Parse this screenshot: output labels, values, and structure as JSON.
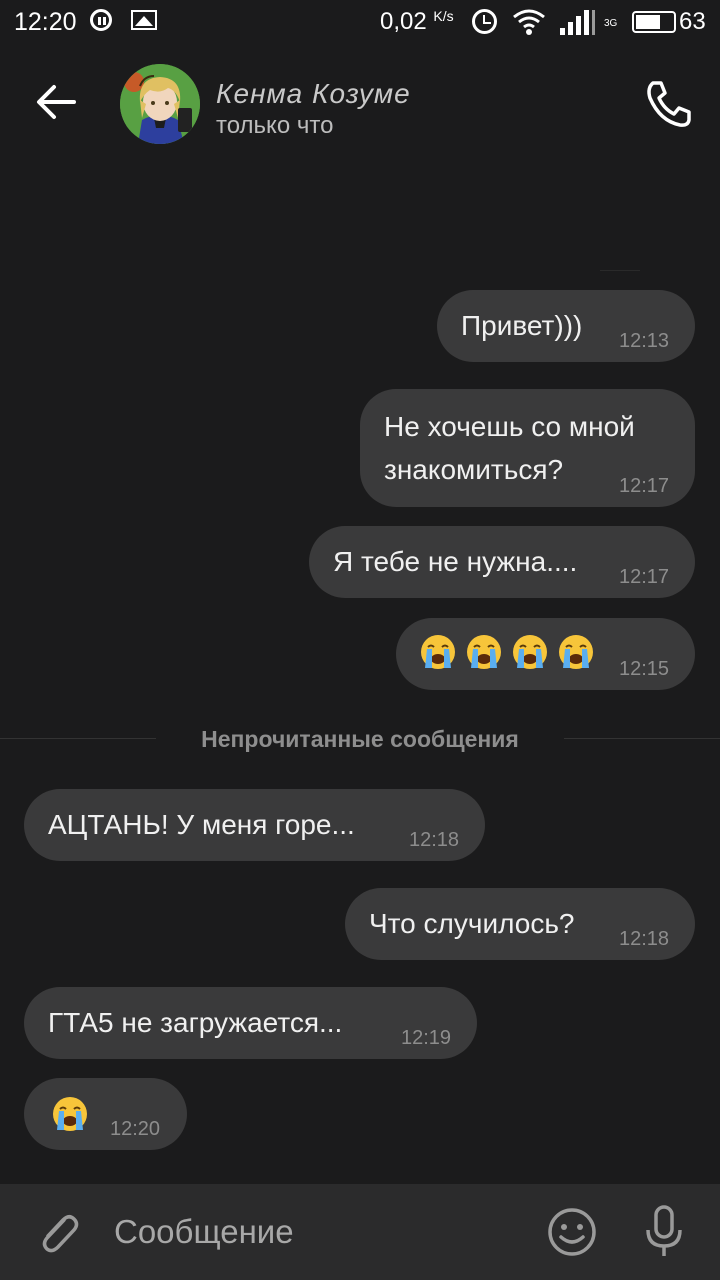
{
  "status_bar": {
    "time": "12:20",
    "speed": "0,02",
    "speed_unit": "K/s",
    "network": "3G",
    "battery": "63"
  },
  "header": {
    "contact_name": "Кенма Козуме",
    "contact_status": "только что"
  },
  "messages": [
    {
      "text": "Привет)))",
      "time": "12:13",
      "direction": "out"
    },
    {
      "text": "Не хочешь со мной знакомиться?",
      "time": "12:17",
      "direction": "out"
    },
    {
      "text": "Я тебе не нужна....",
      "time": "12:17",
      "direction": "out"
    },
    {
      "text": "😭😭😭😭",
      "time": "12:15",
      "direction": "out",
      "emoji": "loudly-crying-face",
      "count": 4
    },
    {
      "text": "АЦТАНЬ! У меня горе...",
      "time": "12:18",
      "direction": "in"
    },
    {
      "text": "Что случилось?",
      "time": "12:18",
      "direction": "out"
    },
    {
      "text": "ГТА5 не загружается...",
      "time": "12:19",
      "direction": "in"
    },
    {
      "text": "😭",
      "time": "12:20",
      "direction": "in",
      "emoji": "loudly-crying-face",
      "count": 1
    }
  ],
  "unread_divider": "Непрочитанные сообщения",
  "composer": {
    "placeholder": "Сообщение"
  },
  "colors": {
    "background": "#1b1b1c",
    "bubble": "#3a3a3b",
    "composer": "#2b2b2c",
    "time_text": "#8d8d8d"
  }
}
